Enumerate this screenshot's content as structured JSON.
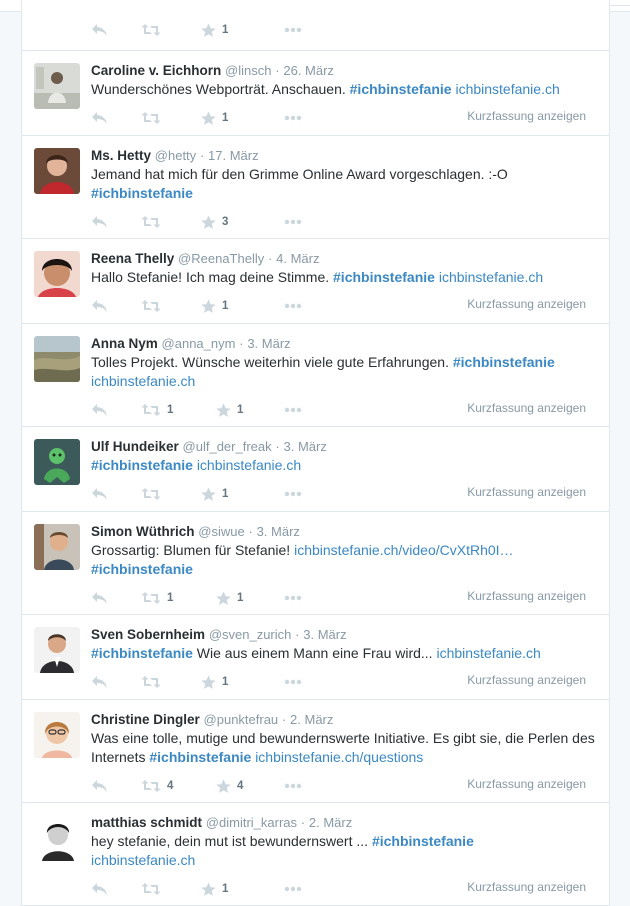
{
  "expand_label": "Kurzfassung anzeigen",
  "colors": {
    "link": "#3b88c3",
    "muted": "#8899a6",
    "icon": "#ccd6dd",
    "border": "#e1e8ed"
  },
  "icons": {
    "reply": "reply-icon",
    "retweet": "retweet-icon",
    "favorite": "star-icon",
    "more": "more-icon"
  },
  "partial": {
    "fav_count": "1"
  },
  "tweets": [
    {
      "fullname": "Caroline v. Eichhorn",
      "username": "@linsch",
      "sep": "·",
      "time": "26. März",
      "line1": "Wunderschönes Webporträt. Anschauen. ",
      "hashtag": "#ichbinstefanie",
      "link": "ichbinstefanie.ch",
      "rt_count": "",
      "fav_count": "1"
    },
    {
      "fullname": "Ms. Hetty",
      "username": "@hetty",
      "sep": "·",
      "time": "17. März",
      "line1": "Jemand hat mich für den Grimme Online Award vorgeschlagen. :-O",
      "hashtag": "#ichbinstefanie",
      "rt_count": "",
      "fav_count": "3"
    },
    {
      "fullname": "Reena Thelly",
      "username": "@ReenaThelly",
      "sep": "·",
      "time": "4. März",
      "line1": "Hallo Stefanie! Ich mag deine Stimme. ",
      "hashtag": "#ichbinstefanie",
      "link": "ichbinstefanie.ch",
      "rt_count": "",
      "fav_count": "1"
    },
    {
      "fullname": "Anna Nym",
      "username": "@anna_nym",
      "sep": "·",
      "time": "3. März",
      "line1": "Tolles Projekt. Wünsche weiterhin viele gute Erfahrungen. ",
      "hashtag": "#ichbinstefanie",
      "link": "ichbinstefanie.ch",
      "rt_count": "1",
      "fav_count": "1"
    },
    {
      "fullname": "Ulf Hundeiker",
      "username": "@ulf_der_freak",
      "sep": "·",
      "time": "3. März",
      "hashtag": "#ichbinstefanie",
      "link": "ichbinstefanie.ch",
      "rt_count": "",
      "fav_count": "1"
    },
    {
      "fullname": "Simon Wüthrich",
      "username": "@siwue",
      "sep": "·",
      "time": "3. März",
      "line1": "Grossartig: Blumen für Stefanie! ",
      "link": "ichbinstefanie.ch/video/CvXtRh0I…",
      "hashtag": "#ichbinstefanie",
      "rt_count": "1",
      "fav_count": "1"
    },
    {
      "fullname": "Sven Sobernheim",
      "username": "@sven_zurich",
      "sep": "·",
      "time": "3. März",
      "hashtag": "#ichbinstefanie",
      "line1": " Wie aus einem Mann eine Frau wird... ",
      "link": "ichbinstefanie.ch",
      "rt_count": "",
      "fav_count": "1"
    },
    {
      "fullname": "Christine Dingler",
      "username": "@punktefrau",
      "sep": "·",
      "time": "2. März",
      "line1": "Was eine tolle, mutige und bewundernswerte Initiative. Es gibt sie, die Perlen des Internets ",
      "hashtag": "#ichbinstefanie",
      "link": "ichbinstefanie.ch/questions",
      "rt_count": "4",
      "fav_count": "4"
    },
    {
      "fullname": "matthias schmidt",
      "username": "@dimitri_karras",
      "sep": "·",
      "time": "2. März",
      "line1": "hey stefanie, dein mut ist bewundernswert ...  ",
      "hashtag": "#ichbinstefanie",
      "link": "ichbinstefanie.ch",
      "rt_count": "",
      "fav_count": "1"
    }
  ]
}
